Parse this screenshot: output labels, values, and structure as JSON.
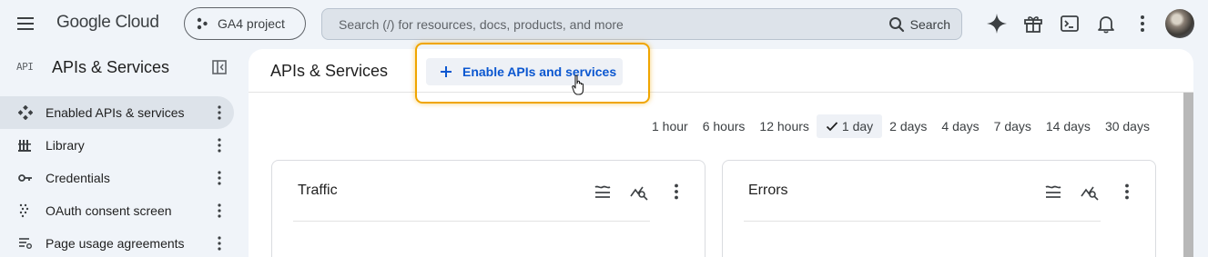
{
  "topbar": {
    "logo": "Google Cloud",
    "project": "GA4 project",
    "search_placeholder": "Search (/) for resources, docs, products, and more",
    "search_button": "Search"
  },
  "sidebar": {
    "api_badge": "API",
    "title": "APIs & Services",
    "items": [
      {
        "label": "Enabled APIs & services",
        "icon": "diamond-nodes-icon",
        "active": true
      },
      {
        "label": "Library",
        "icon": "library-icon"
      },
      {
        "label": "Credentials",
        "icon": "key-icon"
      },
      {
        "label": "OAuth consent screen",
        "icon": "oauth-dots-icon"
      },
      {
        "label": "Page usage agreements",
        "icon": "settings-list-icon"
      }
    ]
  },
  "main": {
    "title": "APIs & Services",
    "enable_button": "Enable APIs and services",
    "time_ranges": [
      "1 hour",
      "6 hours",
      "12 hours",
      "1 day",
      "2 days",
      "4 days",
      "7 days",
      "14 days",
      "30 days"
    ],
    "selected_range": "1 day",
    "cards": [
      {
        "title": "Traffic"
      },
      {
        "title": "Errors"
      }
    ]
  },
  "colors": {
    "accent": "#0b57d0",
    "highlight": "#f0a500",
    "background": "#f0f4f9",
    "active_item": "#dde3ea"
  }
}
